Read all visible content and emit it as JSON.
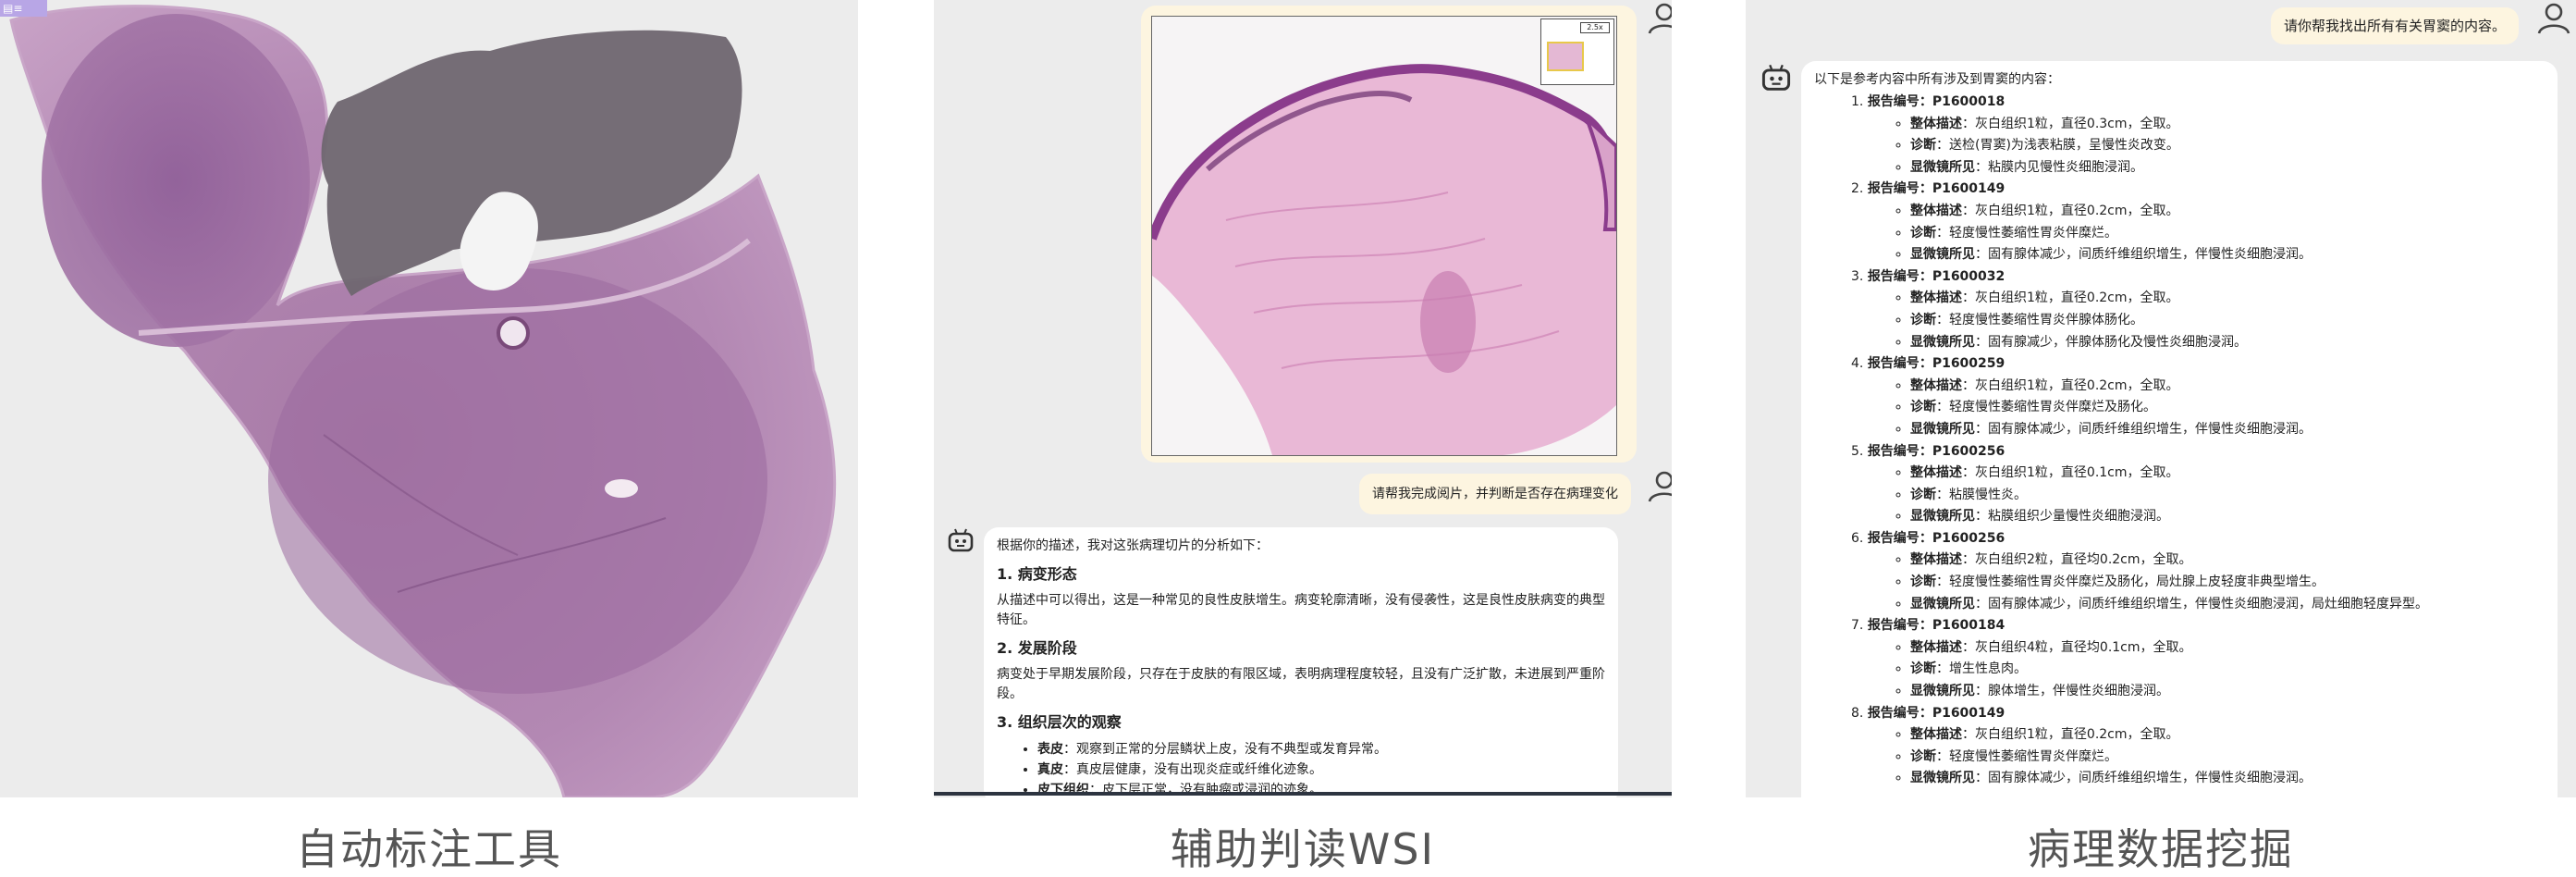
{
  "captions": {
    "panel1": "自动标注工具",
    "panel2": "辅助判读WSI",
    "panel3": "病理数据挖掘"
  },
  "annotation_tool": {
    "corner_tag": "▤≡"
  },
  "wsi_chat": {
    "minimap_zoom": "2.5x",
    "user_prompt": "请帮我完成阅片，并判断是否存在病理变化",
    "bot": {
      "intro": "根据你的描述，我对这张病理切片的分析如下：",
      "sections": [
        {
          "title": "1. 病变形态",
          "body": "从描述中可以得出，这是一种常见的良性皮肤增生。病变轮廓清晰，没有侵袭性，这是良性皮肤病变的典型特征。"
        },
        {
          "title": "2. 发展阶段",
          "body": "病变处于早期发展阶段，只存在于皮肤的有限区域，表明病理程度较轻，且没有广泛扩散，未进展到严重阶段。"
        },
        {
          "title": "3. 组织层次的观察",
          "body": ""
        }
      ],
      "layers": [
        {
          "name": "表皮",
          "text": "：观察到正常的分层鳞状上皮，没有不典型或发育异常。"
        },
        {
          "name": "真皮",
          "text": "：真皮层健康，没有出现炎症或纤维化迹象。"
        },
        {
          "name": "皮下组织",
          "text": "：皮下层正常，没有肿瘤或浸润的迹象。"
        }
      ]
    }
  },
  "mining_chat": {
    "user_prompt": "请你帮我找出所有有关胃窦的内容。",
    "bot_intro": "以下是参考内容中所有涉及到胃窦的内容：",
    "field_labels": {
      "report_no": "报告编号",
      "gross": "整体描述",
      "diagnosis": "诊断",
      "micro": "显微镜所见"
    },
    "reports": [
      {
        "n": "1.",
        "id": "P1600018",
        "gross": "灰白组织1粒，直径0.3cm，全取。",
        "diagnosis": "送检(胃窦)为浅表粘膜，呈慢性炎改变。",
        "micro": "粘膜内见慢性炎细胞浸润。"
      },
      {
        "n": "2.",
        "id": "P1600149",
        "gross": "灰白组织1粒，直径0.2cm，全取。",
        "diagnosis": "轻度慢性萎缩性胃炎伴糜烂。",
        "micro": "固有腺体减少，间质纤维组织增生，伴慢性炎细胞浸润。"
      },
      {
        "n": "3.",
        "id": "P1600032",
        "gross": "灰白组织1粒，直径0.2cm，全取。",
        "diagnosis": "轻度慢性萎缩性胃炎伴腺体肠化。",
        "micro": "固有腺减少，伴腺体肠化及慢性炎细胞浸润。"
      },
      {
        "n": "4.",
        "id": "P1600259",
        "gross": "灰白组织1粒，直径0.2cm，全取。",
        "diagnosis": "轻度慢性萎缩性胃炎伴糜烂及肠化。",
        "micro": "固有腺体减少，间质纤维组织增生，伴慢性炎细胞浸润。"
      },
      {
        "n": "5.",
        "id": "P1600256",
        "gross": "灰白组织1粒，直径0.1cm，全取。",
        "diagnosis": "粘膜慢性炎。",
        "micro": "粘膜组织少量慢性炎细胞浸润。"
      },
      {
        "n": "6.",
        "id": "P1600256",
        "gross": "灰白组织2粒，直径均0.2cm，全取。",
        "diagnosis": "轻度慢性萎缩性胃炎伴糜烂及肠化，局灶腺上皮轻度非典型增生。",
        "micro": "固有腺体减少，间质纤维组织增生，伴慢性炎细胞浸润，局灶细胞轻度异型。"
      },
      {
        "n": "7.",
        "id": "P1600184",
        "gross": "灰白组织4粒，直径均0.1cm，全取。",
        "diagnosis": "增生性息肉。",
        "micro": "腺体增生，伴慢性炎细胞浸润。"
      },
      {
        "n": "8.",
        "id": "P1600149",
        "gross": "灰白组织1粒，直径0.2cm，全取。",
        "diagnosis": "轻度慢性萎缩性胃炎伴糜烂。",
        "micro": "固有腺体减少，间质纤维组织增生，伴慢性炎细胞浸润。"
      }
    ]
  },
  "colors": {
    "panel_bg": "#ececec",
    "user_bubble": "#fdf5e0",
    "tissue_purple": "#b483b0",
    "tissue_dark": "#8a5f93",
    "annotated_region": "#6f6670",
    "caption_text": "#555555"
  },
  "icons": [
    "user-avatar-icon",
    "robot-avatar-icon",
    "image-list-icon"
  ]
}
